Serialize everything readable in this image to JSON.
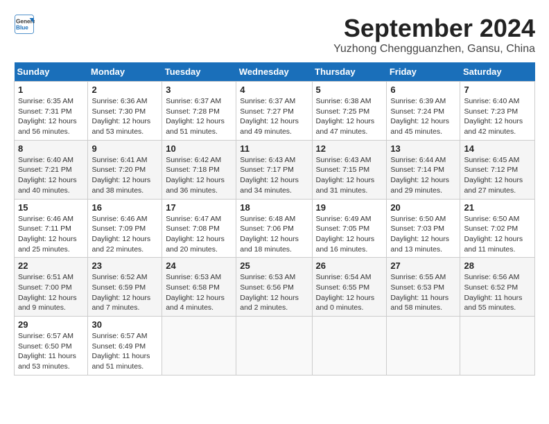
{
  "header": {
    "logo_line1": "General",
    "logo_line2": "Blue",
    "month_year": "September 2024",
    "location": "Yuzhong Chengguanzhen, Gansu, China"
  },
  "columns": [
    "Sunday",
    "Monday",
    "Tuesday",
    "Wednesday",
    "Thursday",
    "Friday",
    "Saturday"
  ],
  "weeks": [
    [
      {
        "day": "1",
        "info": "Sunrise: 6:35 AM\nSunset: 7:31 PM\nDaylight: 12 hours\nand 56 minutes."
      },
      {
        "day": "2",
        "info": "Sunrise: 6:36 AM\nSunset: 7:30 PM\nDaylight: 12 hours\nand 53 minutes."
      },
      {
        "day": "3",
        "info": "Sunrise: 6:37 AM\nSunset: 7:28 PM\nDaylight: 12 hours\nand 51 minutes."
      },
      {
        "day": "4",
        "info": "Sunrise: 6:37 AM\nSunset: 7:27 PM\nDaylight: 12 hours\nand 49 minutes."
      },
      {
        "day": "5",
        "info": "Sunrise: 6:38 AM\nSunset: 7:25 PM\nDaylight: 12 hours\nand 47 minutes."
      },
      {
        "day": "6",
        "info": "Sunrise: 6:39 AM\nSunset: 7:24 PM\nDaylight: 12 hours\nand 45 minutes."
      },
      {
        "day": "7",
        "info": "Sunrise: 6:40 AM\nSunset: 7:23 PM\nDaylight: 12 hours\nand 42 minutes."
      }
    ],
    [
      {
        "day": "8",
        "info": "Sunrise: 6:40 AM\nSunset: 7:21 PM\nDaylight: 12 hours\nand 40 minutes."
      },
      {
        "day": "9",
        "info": "Sunrise: 6:41 AM\nSunset: 7:20 PM\nDaylight: 12 hours\nand 38 minutes."
      },
      {
        "day": "10",
        "info": "Sunrise: 6:42 AM\nSunset: 7:18 PM\nDaylight: 12 hours\nand 36 minutes."
      },
      {
        "day": "11",
        "info": "Sunrise: 6:43 AM\nSunset: 7:17 PM\nDaylight: 12 hours\nand 34 minutes."
      },
      {
        "day": "12",
        "info": "Sunrise: 6:43 AM\nSunset: 7:15 PM\nDaylight: 12 hours\nand 31 minutes."
      },
      {
        "day": "13",
        "info": "Sunrise: 6:44 AM\nSunset: 7:14 PM\nDaylight: 12 hours\nand 29 minutes."
      },
      {
        "day": "14",
        "info": "Sunrise: 6:45 AM\nSunset: 7:12 PM\nDaylight: 12 hours\nand 27 minutes."
      }
    ],
    [
      {
        "day": "15",
        "info": "Sunrise: 6:46 AM\nSunset: 7:11 PM\nDaylight: 12 hours\nand 25 minutes."
      },
      {
        "day": "16",
        "info": "Sunrise: 6:46 AM\nSunset: 7:09 PM\nDaylight: 12 hours\nand 22 minutes."
      },
      {
        "day": "17",
        "info": "Sunrise: 6:47 AM\nSunset: 7:08 PM\nDaylight: 12 hours\nand 20 minutes."
      },
      {
        "day": "18",
        "info": "Sunrise: 6:48 AM\nSunset: 7:06 PM\nDaylight: 12 hours\nand 18 minutes."
      },
      {
        "day": "19",
        "info": "Sunrise: 6:49 AM\nSunset: 7:05 PM\nDaylight: 12 hours\nand 16 minutes."
      },
      {
        "day": "20",
        "info": "Sunrise: 6:50 AM\nSunset: 7:03 PM\nDaylight: 12 hours\nand 13 minutes."
      },
      {
        "day": "21",
        "info": "Sunrise: 6:50 AM\nSunset: 7:02 PM\nDaylight: 12 hours\nand 11 minutes."
      }
    ],
    [
      {
        "day": "22",
        "info": "Sunrise: 6:51 AM\nSunset: 7:00 PM\nDaylight: 12 hours\nand 9 minutes."
      },
      {
        "day": "23",
        "info": "Sunrise: 6:52 AM\nSunset: 6:59 PM\nDaylight: 12 hours\nand 7 minutes."
      },
      {
        "day": "24",
        "info": "Sunrise: 6:53 AM\nSunset: 6:58 PM\nDaylight: 12 hours\nand 4 minutes."
      },
      {
        "day": "25",
        "info": "Sunrise: 6:53 AM\nSunset: 6:56 PM\nDaylight: 12 hours\nand 2 minutes."
      },
      {
        "day": "26",
        "info": "Sunrise: 6:54 AM\nSunset: 6:55 PM\nDaylight: 12 hours\nand 0 minutes."
      },
      {
        "day": "27",
        "info": "Sunrise: 6:55 AM\nSunset: 6:53 PM\nDaylight: 11 hours\nand 58 minutes."
      },
      {
        "day": "28",
        "info": "Sunrise: 6:56 AM\nSunset: 6:52 PM\nDaylight: 11 hours\nand 55 minutes."
      }
    ],
    [
      {
        "day": "29",
        "info": "Sunrise: 6:57 AM\nSunset: 6:50 PM\nDaylight: 11 hours\nand 53 minutes."
      },
      {
        "day": "30",
        "info": "Sunrise: 6:57 AM\nSunset: 6:49 PM\nDaylight: 11 hours\nand 51 minutes."
      },
      {
        "day": "",
        "info": ""
      },
      {
        "day": "",
        "info": ""
      },
      {
        "day": "",
        "info": ""
      },
      {
        "day": "",
        "info": ""
      },
      {
        "day": "",
        "info": ""
      }
    ]
  ]
}
